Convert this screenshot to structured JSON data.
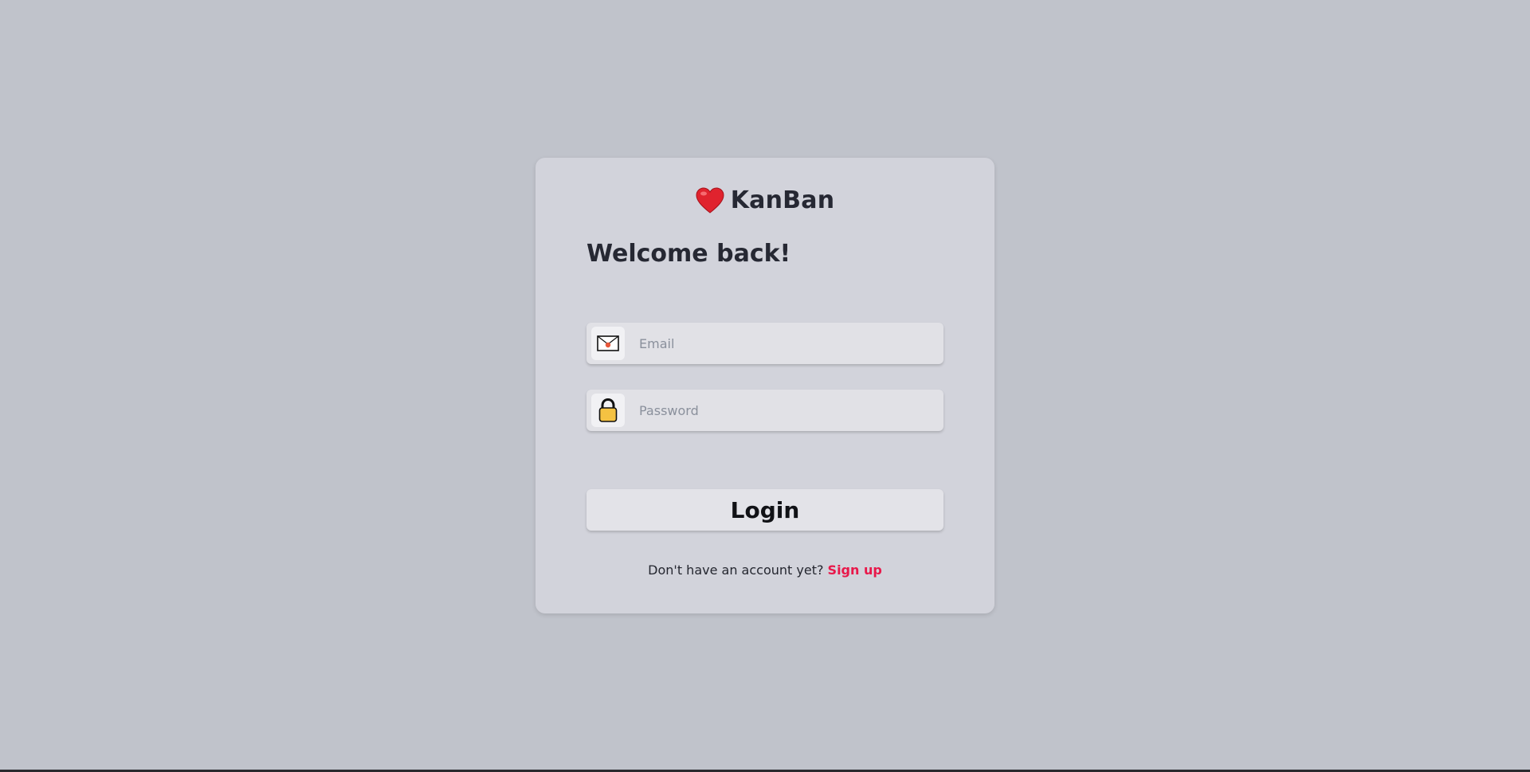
{
  "brand": {
    "icon": "red-heart-icon",
    "name": "KanBan"
  },
  "heading": "Welcome back!",
  "email_field": {
    "icon": "envelope-icon",
    "placeholder": "Email",
    "value": ""
  },
  "password_field": {
    "icon": "lock-icon",
    "placeholder": "Password",
    "value": ""
  },
  "login_button": {
    "label": "Login"
  },
  "signup": {
    "prompt": "Don't have an account yet?",
    "link_label": "Sign up"
  },
  "colors": {
    "background": "#c0c3cb",
    "card": "#d2d3db",
    "accent_link": "#e8184a",
    "heart": "#e0232e",
    "lock": "#f5c242"
  }
}
